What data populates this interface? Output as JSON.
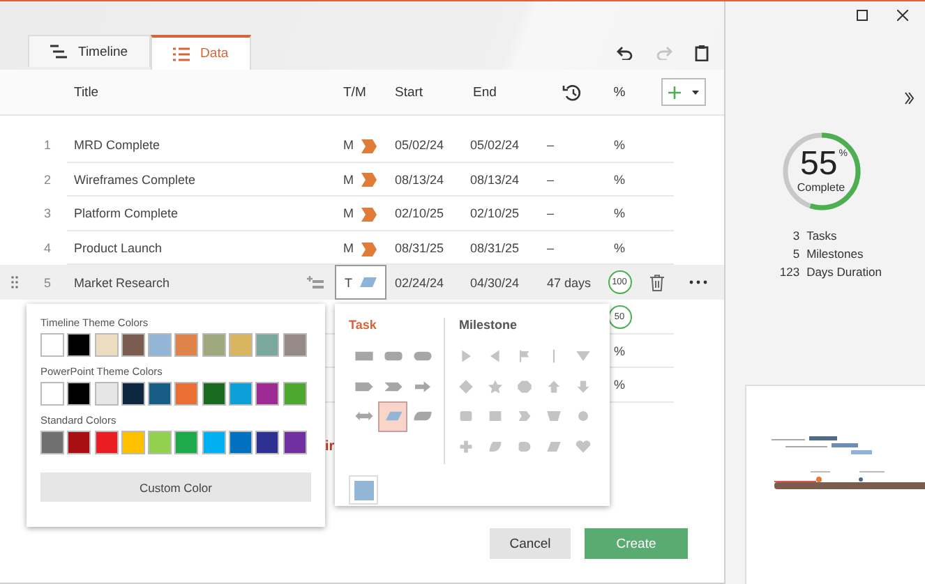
{
  "tabs": [
    {
      "label": "Timeline",
      "kind": "timeline",
      "selected": false
    },
    {
      "label": "Data",
      "kind": "data",
      "selected": true
    }
  ],
  "toolbar": [
    {
      "kind": "undo",
      "disabled": false
    },
    {
      "kind": "redo",
      "disabled": true
    },
    {
      "kind": "clipboard",
      "disabled": false
    }
  ],
  "table": {
    "columns": {
      "title": "Title",
      "type": "T/M",
      "start": "Start",
      "end": "End",
      "percent": "%"
    },
    "rows": [
      {
        "number": "1",
        "title": "MRD Complete",
        "type": "M",
        "marker": {
          "kind": "milestone",
          "color": "#e07b39"
        },
        "start": "05/02/24",
        "end": "05/02/24",
        "duration": "–",
        "percent": {
          "kind": "text",
          "text": "%"
        },
        "selected": false
      },
      {
        "number": "2",
        "title": "Wireframes Complete",
        "type": "M",
        "marker": {
          "kind": "milestone",
          "color": "#e07b39"
        },
        "start": "08/13/24",
        "end": "08/13/24",
        "duration": "–",
        "percent": {
          "kind": "text",
          "text": "%"
        },
        "selected": false
      },
      {
        "number": "3",
        "title": "Platform Complete",
        "type": "M",
        "marker": {
          "kind": "milestone",
          "color": "#e07b39"
        },
        "start": "02/10/25",
        "end": "02/10/25",
        "duration": "–",
        "percent": {
          "kind": "text",
          "text": "%"
        },
        "selected": false
      },
      {
        "number": "4",
        "title": "Product Launch",
        "type": "M",
        "marker": {
          "kind": "milestone",
          "color": "#e07b39"
        },
        "start": "08/31/25",
        "end": "08/31/25",
        "duration": "–",
        "percent": {
          "kind": "text",
          "text": "%"
        },
        "selected": false
      },
      {
        "number": "5",
        "title": "Market Research",
        "type": "T",
        "marker": {
          "kind": "task",
          "color": "#8fb3d6"
        },
        "start": "02/24/24",
        "end": "04/30/24",
        "duration": "47 days",
        "percent": {
          "kind": "ring",
          "text": "100"
        },
        "selected": true
      },
      {
        "percent": {
          "kind": "ring",
          "text": "50"
        },
        "selected": false
      },
      {
        "percent": {
          "kind": "text",
          "text": "%"
        },
        "selected": false
      },
      {
        "percent": {
          "kind": "text",
          "text": "%"
        },
        "selected": false
      }
    ]
  },
  "obscured_text": "ir",
  "color_picker": {
    "sections": [
      {
        "title": "Timeline Theme Colors",
        "colors": [
          {
            "color": "#ffffff"
          },
          {
            "color": "#000000"
          },
          {
            "color": "#ecdcc0"
          },
          {
            "color": "#7b5d4f"
          },
          {
            "color": "#94b6d6"
          },
          {
            "color": "#e0834a"
          },
          {
            "color": "#a0a87e"
          },
          {
            "color": "#d8b55e"
          },
          {
            "color": "#7ba89c"
          },
          {
            "color": "#968a86"
          }
        ]
      },
      {
        "title": "PowerPoint Theme Colors",
        "colors": [
          {
            "color": "#ffffff"
          },
          {
            "color": "#000000"
          },
          {
            "color": "#e7e6e6"
          },
          {
            "color": "#0f2640"
          },
          {
            "color": "#175d86"
          },
          {
            "color": "#ea6f33"
          },
          {
            "color": "#1a6a21"
          },
          {
            "color": "#0da0d8"
          },
          {
            "color": "#9e2a94"
          },
          {
            "color": "#4ea72e"
          }
        ]
      },
      {
        "title": "Standard Colors",
        "colors": [
          {
            "color": "#707070"
          },
          {
            "color": "#a90e12"
          },
          {
            "color": "#e91d22"
          },
          {
            "color": "#ffc000"
          },
          {
            "color": "#92d050"
          },
          {
            "color": "#1ea94a"
          },
          {
            "color": "#00b0f0"
          },
          {
            "color": "#0070c0"
          },
          {
            "color": "#2e3192"
          },
          {
            "color": "#7030a0"
          }
        ]
      }
    ],
    "custom_button": "Custom Color"
  },
  "shape_picker": {
    "task_label": "Task",
    "milestone_label": "Milestone",
    "current_swatch": {
      "color": "#94b6d6"
    },
    "task_shapes": [
      {
        "kind": "rect",
        "selected": false
      },
      {
        "kind": "rounded",
        "selected": false
      },
      {
        "kind": "pill",
        "selected": false
      },
      {
        "kind": "pentagon",
        "selected": false
      },
      {
        "kind": "chevron",
        "selected": false
      },
      {
        "kind": "arrow",
        "selected": false
      },
      {
        "kind": "double-arrow",
        "selected": false
      },
      {
        "kind": "slant",
        "selected": true
      },
      {
        "kind": "leaf",
        "selected": false
      }
    ],
    "milestone_shapes": [
      {
        "kind": "flag-right",
        "selected": false
      },
      {
        "kind": "triangle-left",
        "selected": false
      },
      {
        "kind": "flag",
        "selected": false
      },
      {
        "kind": "line",
        "selected": false
      },
      {
        "kind": "triangle-down",
        "selected": false
      },
      {
        "kind": "diamond",
        "selected": false
      },
      {
        "kind": "star",
        "selected": false
      },
      {
        "kind": "octagon",
        "selected": false
      },
      {
        "kind": "arrow-up",
        "selected": false
      },
      {
        "kind": "arrow-down",
        "selected": false
      },
      {
        "kind": "rounded-square",
        "selected": false
      },
      {
        "kind": "square",
        "selected": false
      },
      {
        "kind": "chevron",
        "selected": false
      },
      {
        "kind": "trapezoid",
        "selected": false
      },
      {
        "kind": "circle",
        "selected": false
      },
      {
        "kind": "plus",
        "selected": false
      },
      {
        "kind": "leaf",
        "selected": false
      },
      {
        "kind": "half-circle",
        "selected": false
      },
      {
        "kind": "parallelogram",
        "selected": false
      },
      {
        "kind": "heart",
        "selected": false
      }
    ]
  },
  "buttons": [
    {
      "label": "Cancel",
      "kind": "secondary"
    },
    {
      "label": "Create",
      "kind": "primary"
    }
  ],
  "summary": {
    "percent": "55",
    "percent_sign": "%",
    "label": "Complete",
    "level": 0.55,
    "stats": [
      {
        "count": "3",
        "label": "Tasks"
      },
      {
        "count": "5",
        "label": "Milestones"
      },
      {
        "count": "123",
        "label": "Days Duration"
      }
    ]
  }
}
